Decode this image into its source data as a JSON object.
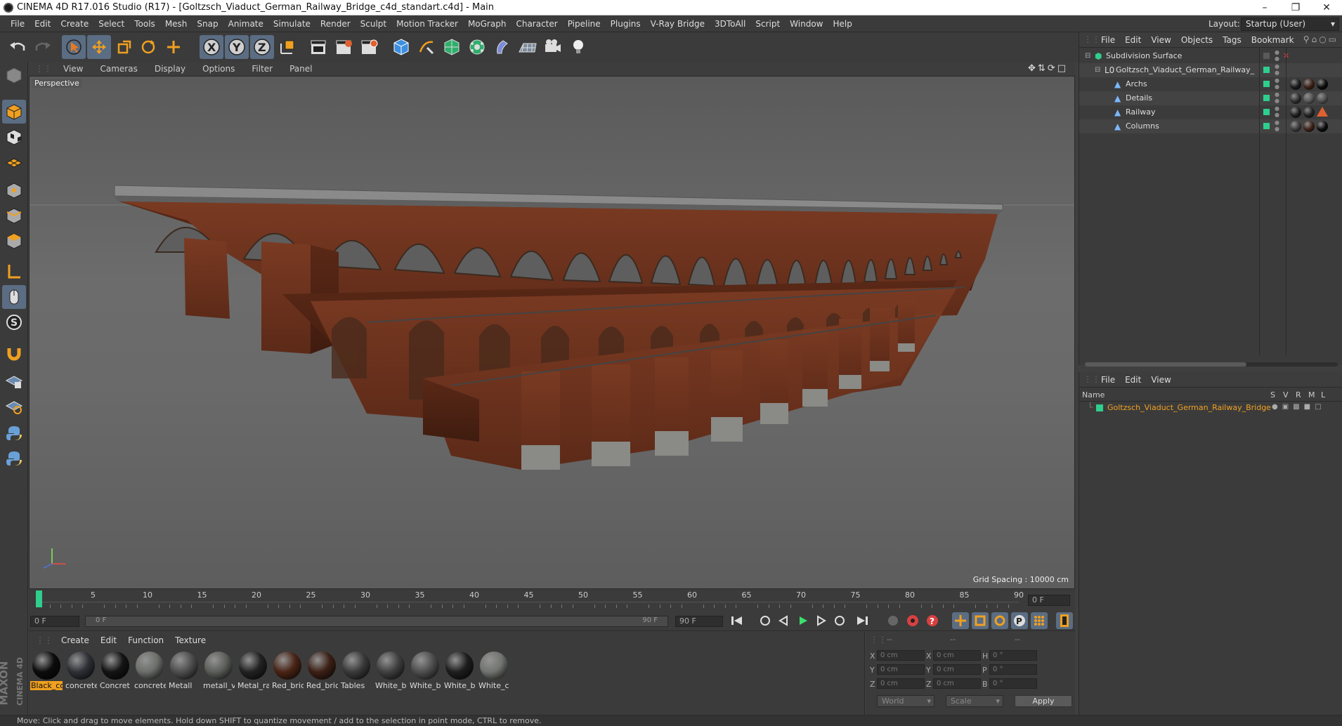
{
  "window": {
    "title": "CINEMA 4D R17.016 Studio (R17) - [Goltzsch_Viaduct_German_Railway_Bridge_c4d_standart.c4d] - Main"
  },
  "menubar": {
    "items": [
      "File",
      "Edit",
      "Create",
      "Select",
      "Tools",
      "Mesh",
      "Snap",
      "Animate",
      "Simulate",
      "Render",
      "Sculpt",
      "Motion Tracker",
      "MoGraph",
      "Character",
      "Pipeline",
      "Plugins",
      "V-Ray Bridge",
      "3DToAll",
      "Script",
      "Window",
      "Help"
    ],
    "layout_label": "Layout:",
    "layout_value": "Startup (User)"
  },
  "viewport": {
    "menu": [
      "View",
      "Cameras",
      "Display",
      "Options",
      "Filter",
      "Panel"
    ],
    "label": "Perspective",
    "grid_spacing": "Grid Spacing : 10000 cm"
  },
  "timeline": {
    "ticks": [
      "0",
      "5",
      "10",
      "15",
      "20",
      "25",
      "30",
      "35",
      "40",
      "45",
      "50",
      "55",
      "60",
      "65",
      "70",
      "75",
      "80",
      "85",
      "90"
    ],
    "current_frame": "0 F",
    "start": "0 F",
    "range_start": "0 F",
    "range_end": "90 F",
    "end": "90 F"
  },
  "materials": {
    "menu": [
      "Create",
      "Edit",
      "Function",
      "Texture"
    ],
    "items": [
      {
        "name": "Black_co",
        "color": "#0c0c0c"
      },
      {
        "name": "concrete",
        "color": "#2e3036"
      },
      {
        "name": "Concret",
        "color": "#141414"
      },
      {
        "name": "concrete",
        "color": "#6c6e6a"
      },
      {
        "name": "Metall",
        "color": "#4e4e4e"
      },
      {
        "name": "metall_v",
        "color": "#5c5e5a"
      },
      {
        "name": "Metal_ra",
        "color": "#222222"
      },
      {
        "name": "Red_bric",
        "color": "#4a2416"
      },
      {
        "name": "Red_bric",
        "color": "#3c2016"
      },
      {
        "name": "Tables",
        "color": "#3a3a3a"
      },
      {
        "name": "White_b",
        "color": "#404040"
      },
      {
        "name": "White_b",
        "color": "#4e4e4e"
      },
      {
        "name": "White_b",
        "color": "#1e1e1e"
      },
      {
        "name": "White_c",
        "color": "#727470"
      }
    ]
  },
  "coords": {
    "headers": [
      "--",
      "--",
      "--"
    ],
    "rows": [
      {
        "l1": "X",
        "v1": "0 cm",
        "l2": "X",
        "v2": "0 cm",
        "l3": "H",
        "v3": "0 °"
      },
      {
        "l1": "Y",
        "v1": "0 cm",
        "l2": "Y",
        "v2": "0 cm",
        "l3": "P",
        "v3": "0 °"
      },
      {
        "l1": "Z",
        "v1": "0 cm",
        "l2": "Z",
        "v2": "0 cm",
        "l3": "B",
        "v3": "0 °"
      }
    ],
    "mode1": "World",
    "mode2": "Scale",
    "apply": "Apply"
  },
  "objects": {
    "menu": [
      "File",
      "Edit",
      "View",
      "Objects",
      "Tags",
      "Bookmark"
    ],
    "items": [
      {
        "name": "Subdivision Surface",
        "indent": 0
      },
      {
        "name": "Goltzsch_Viaduct_German_Railway_Bridg",
        "indent": 1
      },
      {
        "name": "Archs",
        "indent": 2
      },
      {
        "name": "Details",
        "indent": 2
      },
      {
        "name": "Railway",
        "indent": 2
      },
      {
        "name": "Columns",
        "indent": 2
      }
    ]
  },
  "attributes": {
    "menu": [
      "File",
      "Edit",
      "View"
    ],
    "columns": [
      "Name",
      "S",
      "V",
      "R",
      "M",
      "L"
    ],
    "item": "Goltzsch_Viaduct_German_Railway_Bridge"
  },
  "status": {
    "text": "Move: Click and drag to move elements. Hold down SHIFT to quantize movement / add to the selection in point mode, CTRL to remove."
  },
  "brand": {
    "line1": "MAXON",
    "line2": "CINEMA 4D"
  },
  "colors": {
    "accent": "#5b6d83",
    "brick": "#6b3320",
    "selected_name": "#f0a020",
    "green_tag": "#2fce8c"
  }
}
